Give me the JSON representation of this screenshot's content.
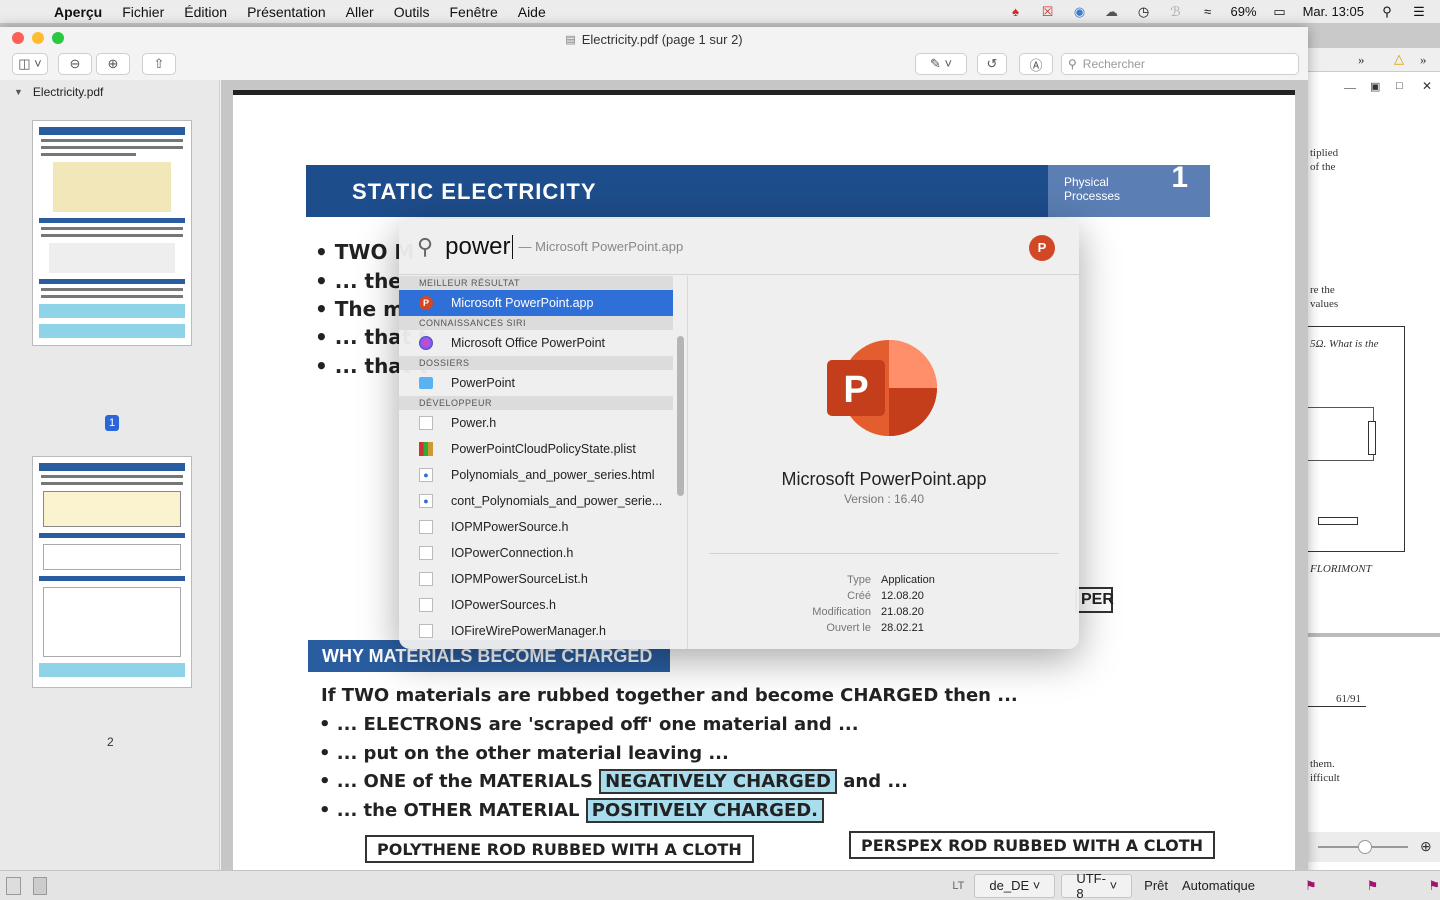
{
  "menubar": {
    "app": "Aperçu",
    "items": [
      "Fichier",
      "Édition",
      "Présentation",
      "Aller",
      "Outils",
      "Fenêtre",
      "Aide"
    ],
    "battery": "69%",
    "clock": "Mar. 13:05"
  },
  "window": {
    "title": "Electricity.pdf (page 1 sur 2)",
    "search_placeholder": "Rechercher"
  },
  "sidebar": {
    "filename": "Electricity.pdf",
    "pages": [
      "1",
      "2"
    ]
  },
  "document": {
    "banner_title": "STATIC ELECTRICITY",
    "banner_sub1": "Physical",
    "banner_sub2": "Processes",
    "banner_num": "1",
    "partial_lines": [
      "TWO M",
      "... they a",
      "The ma",
      "... that t",
      "... that t"
    ],
    "per_box": "PER",
    "section_header": "WHY MATERIALS BECOME CHARGED",
    "body": {
      "line1": "If TWO materials are rubbed together and become CHARGED then ...",
      "line2": "... ELECTRONS are 'scraped off' one material and ...",
      "line3": "... put on the other material leaving ...",
      "line4a": "... ONE of the MATERIALS",
      "line4b": "NEGATIVELY CHARGED",
      "line4c": "and ...",
      "line5a": "... the OTHER MATERIAL",
      "line5b": "POSITIVELY CHARGED."
    },
    "rod1": "POLYTHENE ROD RUBBED WITH A CLOTH",
    "rod2": "PERSPEX ROD RUBBED WITH A CLOTH"
  },
  "spotlight": {
    "query": "power",
    "suggestion": "— Microsoft PowerPoint.app",
    "sections": [
      {
        "title": "MEILLEUR RÉSULTAT",
        "items": [
          {
            "label": "Microsoft PowerPoint.app",
            "icon": "powerpoint-icon"
          }
        ]
      },
      {
        "title": "CONNAISSANCES SIRI",
        "items": [
          {
            "label": "Microsoft Office PowerPoint",
            "icon": "siri-icon"
          }
        ]
      },
      {
        "title": "DOSSIERS",
        "items": [
          {
            "label": "PowerPoint",
            "icon": "folder-icon"
          }
        ]
      },
      {
        "title": "DÉVELOPPEUR",
        "items": [
          {
            "label": "Power.h",
            "icon": "document-icon"
          },
          {
            "label": "PowerPointCloudPolicyState.plist",
            "icon": "plist-icon"
          },
          {
            "label": "Polynomials_and_power_series.html",
            "icon": "html-icon"
          },
          {
            "label": "cont_Polynomials_and_power_serie...",
            "icon": "html-icon"
          },
          {
            "label": "IOPMPowerSource.h",
            "icon": "document-icon"
          },
          {
            "label": "IOPowerConnection.h",
            "icon": "document-icon"
          },
          {
            "label": "IOPMPowerSourceList.h",
            "icon": "document-icon"
          },
          {
            "label": "IOPowerSources.h",
            "icon": "document-icon"
          },
          {
            "label": "IOFireWirePowerManager.h",
            "icon": "document-icon"
          }
        ]
      }
    ],
    "preview": {
      "name": "Microsoft PowerPoint.app",
      "version": "Version : 16.40",
      "meta": [
        {
          "k": "Type",
          "v": "Application"
        },
        {
          "k": "Créé",
          "v": "12.08.20"
        },
        {
          "k": "Modification",
          "v": "21.08.20"
        },
        {
          "k": "Ouvert le",
          "v": "28.02.21"
        }
      ]
    }
  },
  "bgwindow": {
    "lines": [
      "tiplied",
      "of the",
      "re the",
      "values",
      "5Ω. What is the",
      "FLORIMONT",
      "61/91",
      "them.",
      "ifficult"
    ]
  },
  "bottombar": {
    "lang": "de_DE",
    "encoding": "UTF-8",
    "status": "Prêt",
    "mode": "Automatique"
  },
  "colors": {
    "accent": "#2f6fd8",
    "powerpoint": "#d24726",
    "banner": "#1e4d8c",
    "highlight": "#a8ddee"
  }
}
